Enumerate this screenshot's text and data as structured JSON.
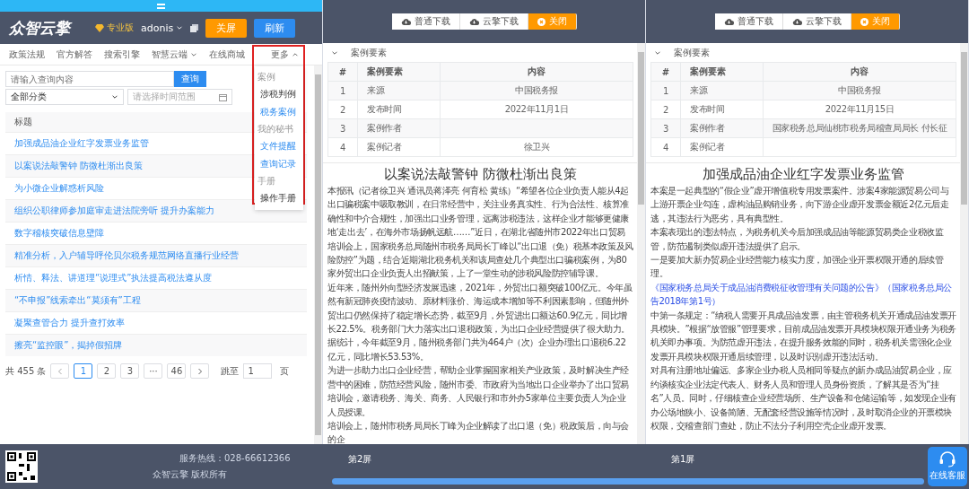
{
  "left_panel": {
    "logo": "众智云擎",
    "edition": "专业版",
    "user": "adonis",
    "buttons": [
      {
        "label": "关屏",
        "kind": "warning"
      },
      {
        "label": "刷新",
        "kind": "primary"
      }
    ],
    "nav": [
      {
        "label": "政策法规",
        "has_menu": false,
        "expanded": false
      },
      {
        "label": "官方解答",
        "has_menu": false,
        "expanded": false
      },
      {
        "label": "搜索引擎",
        "has_menu": false,
        "expanded": false
      },
      {
        "label": "智慧云端",
        "has_menu": true,
        "expanded": false
      },
      {
        "label": "在线商城",
        "has_menu": false,
        "expanded": false
      },
      {
        "label": "更多",
        "has_menu": true,
        "expanded": true
      }
    ],
    "more_menu": [
      {
        "title": "案例",
        "items": [
          {
            "label": "涉税判例",
            "selected": false
          },
          {
            "label": "税务案例",
            "selected": true
          }
        ]
      },
      {
        "title": "我的秘书",
        "items": [
          {
            "label": "文件提醒",
            "selected": true
          },
          {
            "label": "查询记录",
            "selected": true
          }
        ]
      },
      {
        "title": "手册",
        "items": [
          {
            "label": "操作手册",
            "selected": false
          }
        ]
      }
    ],
    "search": {
      "placeholder": "请输入查询内容",
      "button": "查询",
      "category": "全部分类",
      "date_placeholder": "请选择时间范围"
    },
    "table": {
      "column": "标题",
      "rows": [
        "加强成品油企业红字发票业务监管",
        "以案说法敲警钟 防微杜渐出良策",
        "为小微企业解惑析风险",
        "组织公职律师参加庭审走进法院旁听 提升办案能力",
        "数字稽核突破信息壁障",
        "精准分析，入户辅导呼伦贝尔税务规范网络直播行业经营",
        "析情、释法、讲道理“说理式”执法提高税法遵从度",
        "“不申报”线索牵出“莫须有”工程",
        "凝聚查管合力 提升查打效率",
        "擦亮“监控眼”，揭掉假招牌"
      ]
    },
    "pagination": {
      "total": "共 455 条",
      "pages": [
        {
          "label": "1",
          "selected": true
        },
        {
          "label": "2",
          "selected": false
        },
        {
          "label": "3",
          "selected": false
        },
        {
          "label": "···",
          "selected": false
        },
        {
          "label": "46",
          "selected": false
        }
      ],
      "jump_label": "跳至",
      "jump_value": "1",
      "unit": "页"
    },
    "footer": {
      "hotline": "服务热线：028-66612366",
      "copyright": "众智云擎 版权所有"
    }
  },
  "viewers": [
    {
      "buttons": [
        {
          "label": "普通下载",
          "kind": "download"
        },
        {
          "label": "云擎下载",
          "kind": "download"
        },
        {
          "label": "关闭",
          "kind": "close"
        }
      ],
      "section": "案例要素",
      "expanded": true,
      "columns": [
        "#",
        "案例要素",
        "内容"
      ],
      "rows": [
        [
          "1",
          "来源",
          "中国税务报"
        ],
        [
          "2",
          "发布时间",
          "2022年11月1日"
        ],
        [
          "3",
          "案例作者",
          ""
        ],
        [
          "4",
          "案例记者",
          "徐卫兴"
        ]
      ],
      "title": "以案说法敲警钟 防微杜渐出良策",
      "paragraphs": [
        {
          "text": "本报讯（记者徐卫兴 通讯员蒋泽亮 何育松 黄练）“希望各位企业负责人能从4起出口骗税案中吸取教训，在日常经营中，关注业务真实性、行为合法性、核算准确性和中介合规性，加强出口业务管理，远离涉税违法，这样企业才能够更健康地‘走出去’，在海外市场扬帆远航……”近日，在湖北省随州市2022年出口贸易培训会上，国家税务总局随州市税务局局长丁峰以“出口退（免）税基本政策及风险防控”为题，结合近期湖北税务机关和该局查处几个典型出口骗税案例，为80家外贸出口企业负责人出招献策，上了一堂生动的涉税风险防控辅导课。"
        },
        {
          "text": "近年来，随州外向型经济发展迅速，2021年，外贸出口额突破100亿元。今年虽然有新冠肺炎疫情波动、原材料涨价、海运成本增加等不利因素影响，但随州外贸出口仍然保持了稳定增长态势，截至9月，外贸进出口额达60.9亿元，同比增长22.5%。税务部门大力落实出口退税政策，为出口企业经营提供了很大助力。据统计，今年截至9月，随州税务部门共为464户（次）企业办理出口退税6.22亿元，同比增长53.53%。"
        },
        {
          "text": "为进一步助力出口企业经营，帮助企业掌握国家相关产业政策，及时解决生产经营中的困难，防范经营风险，随州市委、市政府为当地出口企业举办了出口贸易培训会，邀请税务、海关、商务、人民银行和市外办5家单位主要负责人为企业人员授课。"
        },
        {
          "text": "培训会上，随州市税务局局长丁峰为企业解读了出口退（免）税政策后，向与会的企"
        }
      ],
      "screen_label": "第2屏"
    },
    {
      "buttons": [
        {
          "label": "普通下载",
          "kind": "download"
        },
        {
          "label": "云擎下载",
          "kind": "download"
        },
        {
          "label": "关闭",
          "kind": "close"
        }
      ],
      "section": "案例要素",
      "expanded": true,
      "columns": [
        "#",
        "案例要素",
        "内容"
      ],
      "rows": [
        [
          "1",
          "来源",
          "中国税务报"
        ],
        [
          "2",
          "发布时间",
          "2022年11月15日"
        ],
        [
          "3",
          "案例作者",
          "国家税务总局仙桃市税务局稽查局局长 付长征"
        ],
        [
          "4",
          "案例记者",
          ""
        ]
      ],
      "title": "加强成品油企业红字发票业务监管",
      "paragraphs": [
        {
          "text": "本案是一起典型的“假企业”虚开增值税专用发票案件。涉案4家能源贸易公司与上游开票企业勾连，虚构油品购销业务，向下游企业虚开发票金额近2亿元后走逃，其违法行为恶劣，具有典型性。"
        },
        {
          "text": "本案表现出的违法特点，为税务机关今后加强成品油等能源贸易类企业税收监管，防范遏制类似虚开违法提供了启示。"
        },
        {
          "text": "一是要加大新办贸易企业经营能力核实力度，加强企业开票权限开通的后续管理。"
        },
        {
          "link": "《国家税务总局关于成品油消费税征收管理有关问题的公告》（国家税务总局公告2018年第1号）",
          "text": "中第一条规定：“纳税人需要开具成品油发票，由主管税务机关开通成品油发票开具模块。”根据“放管服”管理要求，目前成品油发票开具模块权限开通业务为税务机关即办事项。为防范虚开违法，在提升服务效能的同时，税务机关需强化企业发票开具模块权限开通后续管理，以及时识别虚开违法活动。"
        },
        {
          "text": "对具有注册地址偏远、多家企业办税人员相同等疑点的新办成品油贸易企业，应约谈核实企业法定代表人、财务人员和管理人员身份资质，了解其是否为“挂名”人员。同时，仔细核查企业经营场所、生产设备和仓储运输等，如发现企业有办公场地狭小、设备简陋、无配套经营设施等情况时，及时取消企业的开票模块权限，交稽查部门查处，防止不法分子利用空壳企业虚开发票。"
        }
      ],
      "screen_label": "第1屏"
    }
  ],
  "service_button": "在线客服"
}
